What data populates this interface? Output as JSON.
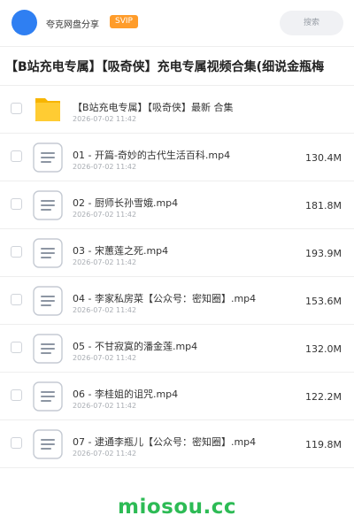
{
  "header": {
    "app_name": "夸克网盘分享",
    "badge": "SVIP",
    "search_placeholder": "搜索",
    "avatar_color": "#2f7ff2",
    "badge_color": "#ff9c2a"
  },
  "share_title": "【B站充电专属】【吸奇侠】充电专属视频合集(细说金瓶梅",
  "files": [
    {
      "type": "folder",
      "icon": "folder-icon",
      "name": "【B站充电专属】【吸奇侠】最新 合集",
      "date": "2026-07-02 11:42",
      "size": ""
    },
    {
      "type": "video",
      "icon": "file-icon",
      "name": "01 - 开篇-奇妙的古代生活百科.mp4",
      "date": "2026-07-02 11:42",
      "size": "130.4M"
    },
    {
      "type": "video",
      "icon": "file-icon",
      "name": "02 - 厨师长孙雪娥.mp4",
      "date": "2026-07-02 11:42",
      "size": "181.8M"
    },
    {
      "type": "video",
      "icon": "file-icon",
      "name": "03 - 宋蕙莲之死.mp4",
      "date": "2026-07-02 11:42",
      "size": "193.9M"
    },
    {
      "type": "video",
      "icon": "file-icon",
      "name": "04 - 李家私房菜【公众号：密知圈】.mp4",
      "date": "2026-07-02 11:42",
      "size": "153.6M"
    },
    {
      "type": "video",
      "icon": "file-icon",
      "name": "05 - 不甘寂寞的潘金莲.mp4",
      "date": "2026-07-02 11:42",
      "size": "132.0M"
    },
    {
      "type": "video",
      "icon": "file-icon",
      "name": "06 - 李桂姐的诅咒.mp4",
      "date": "2026-07-02 11:42",
      "size": "122.2M"
    },
    {
      "type": "video",
      "icon": "file-icon",
      "name": "07 - 逮通李瓶儿【公众号：密知圈】.mp4",
      "date": "2026-07-02 11:42",
      "size": "119.8M"
    }
  ],
  "footer": {
    "watermark": "miosou.cc",
    "watermark_color": "#2dbb55"
  }
}
